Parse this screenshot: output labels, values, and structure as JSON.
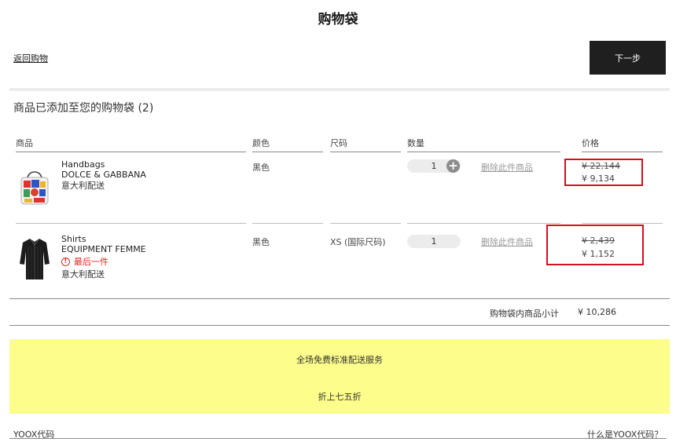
{
  "header": {
    "title": "购物袋",
    "back_label": "返回购物",
    "next_label": "下一步"
  },
  "cart": {
    "added_message": "商品已添加至您的购物袋 (2)",
    "columns": {
      "product": "商品",
      "color": "颜色",
      "size": "尺码",
      "quantity": "数量",
      "price": "价格"
    },
    "items": [
      {
        "category": "Handbags",
        "brand": "DOLCE & GABBANA",
        "shipping": "意大利配送",
        "color": "黑色",
        "size": "",
        "quantity": "1",
        "remove_label": "删除此件商品",
        "price_original": "¥ 22,144",
        "price_current": "¥ 9,134",
        "icon": "handbag-thumbnail"
      },
      {
        "category": "Shirts",
        "brand": "EQUIPMENT FEMME",
        "stock_note": "最后一件",
        "shipping": "意大利配送",
        "color": "黑色",
        "size": "XS (国际尺码)",
        "quantity": "1",
        "remove_label": "删除此件商品",
        "price_original": "¥ 2,439",
        "price_current": "¥ 1,152",
        "icon": "shirt-thumbnail"
      }
    ],
    "subtotal_label": "购物袋内商品小计",
    "subtotal_value": "¥ 10,286"
  },
  "promo": {
    "line1": "全场免费标准配送服务",
    "line2": "折上七五折"
  },
  "footer": {
    "code_label": "YOOX代码",
    "code_help": "什么是YOOX代码？"
  },
  "colors": {
    "highlight_box": "#d6101c",
    "promo_bg": "#fdfd8b",
    "button_bg": "#1f1f1f",
    "warning": "#e4261f"
  }
}
